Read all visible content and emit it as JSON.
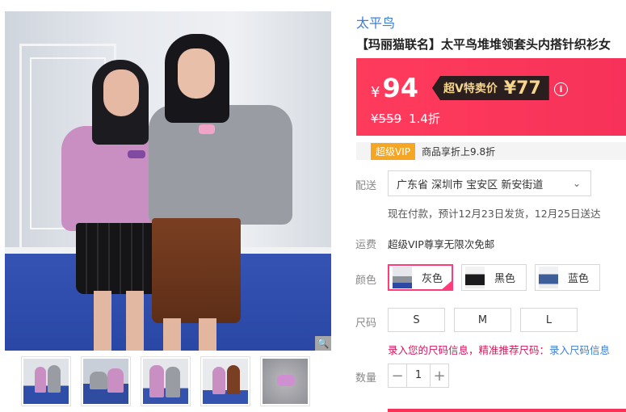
{
  "product": {
    "brand": "太平鸟",
    "title": "【玛丽猫联名】太平鸟堆堆领套头内搭针织衫女"
  },
  "price": {
    "currency": "¥",
    "current": "94",
    "vip_label": "超V特卖价",
    "vip_price": "¥77",
    "original": "¥559",
    "discount": "1.4折",
    "accent_color": "#f7325a"
  },
  "vip_promo": {
    "badge": "超级VIP",
    "text": "商品享折上9.8折"
  },
  "delivery": {
    "label": "配送",
    "region": "广东省 深圳市 宝安区 新安街道",
    "note": "现在付款，预计12月23日发货，12月25日送达"
  },
  "freight": {
    "label": "运费",
    "value": "超级VIP尊享无限次免邮"
  },
  "color": {
    "label": "颜色",
    "options": [
      "灰色",
      "黑色",
      "蓝色"
    ],
    "selected": "灰色"
  },
  "size": {
    "label": "尺码",
    "options": [
      "S",
      "M",
      "L"
    ],
    "hint_prefix": "录入您的尺码信息，精准推荐尺码：",
    "hint_link": "录入尺码信息"
  },
  "quantity": {
    "label": "数量",
    "value": "1"
  },
  "icons": {
    "zoom": "zoom-icon",
    "info": "info-icon",
    "dropdown": "chevron-down-icon",
    "check": "check-icon"
  }
}
